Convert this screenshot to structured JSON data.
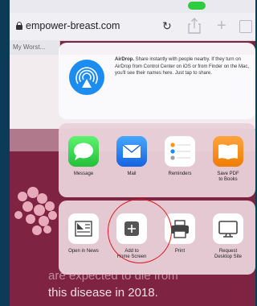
{
  "browser": {
    "url": "empower-breast.com",
    "tab_label": "My Worst..."
  },
  "share_sheet": {
    "airdrop": {
      "title": "AirDrop.",
      "description": "Share instantly with people nearby. If they turn on AirDrop from Control Center on iOS or from Finder on the Mac, you'll see their names here. Just tap to share."
    },
    "apps": [
      {
        "label": "Message",
        "icon": "message-icon"
      },
      {
        "label": "Mail",
        "icon": "mail-icon"
      },
      {
        "label": "Reminders",
        "icon": "reminders-icon"
      },
      {
        "label": "Save PDF\nto Books",
        "icon": "books-icon"
      }
    ],
    "actions": [
      {
        "label": "Open in News",
        "icon": "news-icon"
      },
      {
        "label": "Add to\nHome Screen",
        "icon": "add-square-icon"
      },
      {
        "label": "Print",
        "icon": "printer-icon"
      },
      {
        "label": "Request\nDesktop Site",
        "icon": "desktop-icon"
      }
    ]
  },
  "page": {
    "text_line_1": "are expected to die from",
    "text_line_2": "this disease in 2018."
  },
  "colors": {
    "page_bg": "#7e2342",
    "highlight_circle": "#e0191f"
  }
}
